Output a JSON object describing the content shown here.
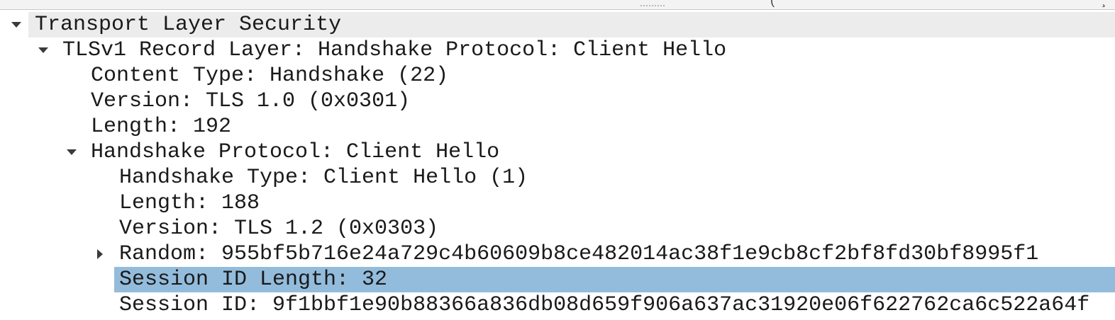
{
  "header_strip": {
    "grip_icon": "splitter-dots-icon",
    "corner_glyphs": [
      "(",
      "̧"
    ]
  },
  "tree": {
    "rows": [
      {
        "label": "Transport Layer Security"
      },
      {
        "label": "TLSv1 Record Layer: Handshake Protocol: Client Hello"
      },
      {
        "label": "Content Type: Handshake (22)"
      },
      {
        "label": "Version: TLS 1.0 (0x0301)"
      },
      {
        "label": "Length: 192"
      },
      {
        "label": "Handshake Protocol: Client Hello"
      },
      {
        "label": "Handshake Type: Client Hello (1)"
      },
      {
        "label": "Length: 188"
      },
      {
        "label": "Version: TLS 1.2 (0x0303)"
      },
      {
        "label": "Random: 955bf5b716e24a729c4b60609b8ce482014ac38f1e9cb8cf2bf8fd30bf8995f1"
      },
      {
        "label": "Session ID Length: 32"
      },
      {
        "label": "Session ID: 9f1bbf1e90b88366a836db08d659f906a637ac31920e06f622762ca6c522a64f"
      }
    ],
    "selected_row": "Session ID Length: 32"
  },
  "colors": {
    "selected_row_bg": "#93bcdc",
    "header_row_bg": "#ececec",
    "text": "#1a1a1a"
  }
}
